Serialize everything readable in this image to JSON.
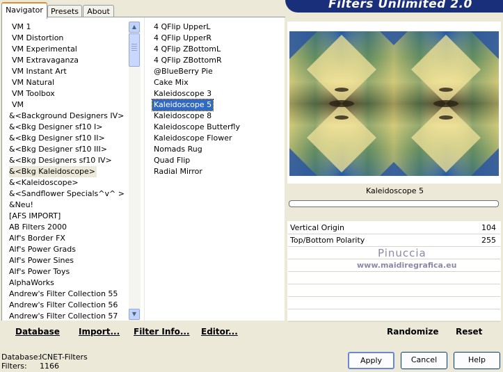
{
  "tabs": [
    "Navigator",
    "Presets",
    "About"
  ],
  "banner_title": "Filters Unlimited 2.0",
  "categories": [
    "VM 1",
    "VM Distortion",
    "VM Experimental",
    "VM Extravaganza",
    "VM Instant Art",
    "VM Natural",
    "VM Toolbox",
    "VM",
    "&<Background Designers IV>",
    "&<Bkg Designer sf10 I>",
    "&<Bkg Designer sf10 II>",
    "&<Bkg Designer sf10 III>",
    "&<Bkg Designers sf10 IV>",
    "&<Bkg Kaleidoscope>",
    "&<Kaleidoscope>",
    "&<Sandflower Specials^v^ >",
    "&Neu!",
    "[AFS IMPORT]",
    "AB Filters 2000",
    "Alf's Border FX",
    "Alf's Power Grads",
    "Alf's Power Sines",
    "Alf's Power Toys",
    "AlphaWorks",
    "Andrew's Filter Collection 55",
    "Andrew's Filter Collection 56",
    "Andrew's Filter Collection 57"
  ],
  "selected_category": "&<Bkg Kaleidoscope>",
  "filters": [
    "4 QFlip UpperL",
    "4 QFlip UpperR",
    "4 QFlip ZBottomL",
    "4 QFlip ZBottomR",
    "@BlueBerry Pie",
    "Cake Mix",
    "Kaleidoscope 3",
    "Kaleidoscope 5",
    "Kaleidoscope 8",
    "Kaleidoscope Butterfly",
    "Kaleidoscope Flower",
    "Nomads Rug",
    "Quad Flip",
    "Radial Mirror"
  ],
  "selected_filter": "Kaleidoscope 5",
  "left_buttons": {
    "database": "Database",
    "import": "Import...",
    "filter_info": "Filter Info...",
    "editor": "Editor..."
  },
  "preview_label": "Kaleidoscope 5",
  "params": [
    {
      "name": "Vertical Origin",
      "value": "104"
    },
    {
      "name": "Top/Bottom Polarity",
      "value": "255"
    }
  ],
  "right_buttons": {
    "randomize": "Randomize",
    "reset": "Reset"
  },
  "watermark": {
    "line1": "Pinuccia",
    "line2": "www.maidiregrafica.eu"
  },
  "status": {
    "db_label": "Database:",
    "db_value": "ICNET-Filters",
    "filters_label": "Filters:",
    "filters_value": "1166"
  },
  "dialog_buttons": {
    "apply": "Apply",
    "cancel": "Cancel",
    "help": "Help"
  },
  "icons": {
    "scroll_up": "chevron-up-icon",
    "scroll_down": "chevron-down-icon"
  },
  "colors": {
    "selection": "#316ac5",
    "banner": "#1a2f7a",
    "tab_accent": "#e68b2c"
  }
}
